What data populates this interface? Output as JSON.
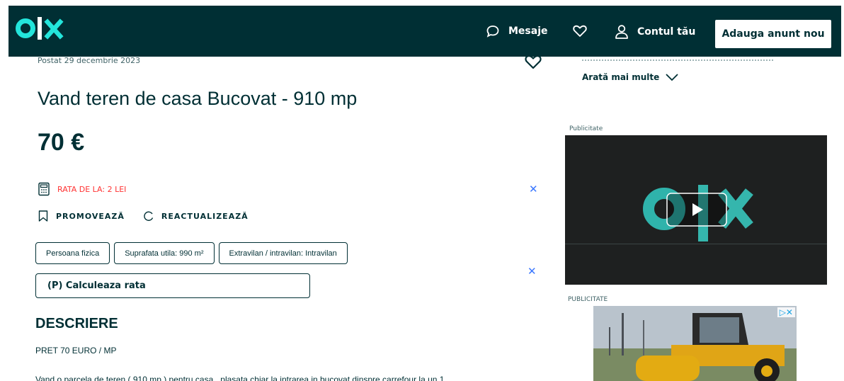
{
  "header": {
    "logo_text": "olx",
    "messages_label": "Mesaje",
    "account_label": "Contul tău",
    "post_button_label": "Adauga anunt nou"
  },
  "listing": {
    "posted": "Postat 29 decembrie 2023",
    "title": "Vand teren de casa Bucovat - 910 mp",
    "price": "70 €",
    "installment": "RATA DE LA: 2 LEI",
    "promote_label": "PROMOVEAZĂ",
    "refresh_label": "REACTUALIZEAZĂ",
    "tags": [
      "Persoana fizica",
      "Suprafata utila: 990 m²",
      "Extravilan / intravilan: Intravilan"
    ],
    "calc_label": "(P) Calculeaza rata",
    "description_heading": "DESCRIERE",
    "description_price": "PRET 70 EURO / MP",
    "description_body": "Vand o parcela de teren ( 910 mp ) pentru casa , plasata chiar la intrarea in bucovat dinspre carrefour la un 1"
  },
  "sidebar": {
    "show_more_label": "Arată mai multe",
    "ad_label_1": "Publicitate",
    "ad_label_2": "PUBLICITATE"
  },
  "colors": {
    "brand_dark": "#002f34",
    "brand_teal": "#23e5db",
    "installment_red": "#ff3333",
    "close_blue": "#3a77ff"
  },
  "icons": [
    "olx-logo",
    "chat-icon",
    "heart-icon",
    "user-icon",
    "calculator-icon",
    "close-icon",
    "bookmark-icon",
    "refresh-icon",
    "chevron-down-icon",
    "play-icon",
    "adchoices-icon"
  ]
}
